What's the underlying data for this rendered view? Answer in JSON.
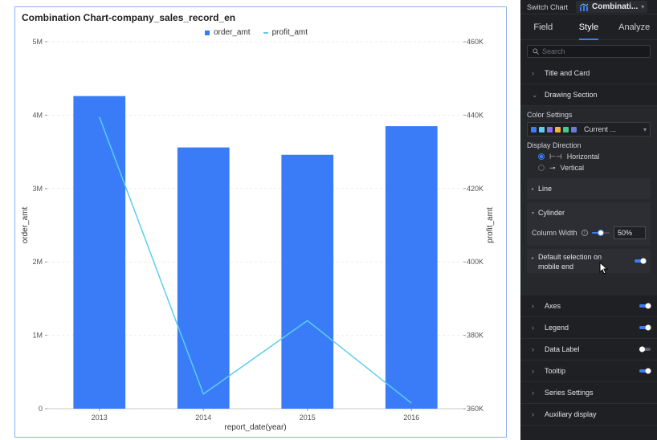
{
  "chart_data": {
    "type": "bar",
    "title": "Combination Chart-company_sales_record_en",
    "categories": [
      "2013",
      "2014",
      "2015",
      "2016"
    ],
    "series": [
      {
        "name": "order_amt",
        "type": "bar",
        "axis": "left",
        "values": [
          4260000,
          3560000,
          3460000,
          3850000
        ]
      },
      {
        "name": "profit_amt",
        "type": "line",
        "axis": "right",
        "values": [
          439500,
          364000,
          384000,
          361500
        ]
      }
    ],
    "xlabel": "report_date(year)",
    "ylabel": "order_amt",
    "y2label": "profit_amt",
    "ylim": [
      0,
      5000000
    ],
    "y2lim": [
      360000,
      460000
    ],
    "yticks": [
      "0",
      "1M",
      "2M",
      "3M",
      "4M",
      "5M"
    ],
    "y2ticks": [
      "360K",
      "380K",
      "400K",
      "420K",
      "440K",
      "460K"
    ],
    "grid": true,
    "legend_position": "top-center",
    "colors": {
      "bar": "#3a7cf7",
      "line": "#5ccdf2"
    }
  },
  "panel": {
    "switch_chart_label": "Switch Chart",
    "chart_type_label": "Combinati...",
    "tabs": [
      "Field",
      "Style",
      "Analyze"
    ],
    "active_tab": "Style",
    "search_placeholder": "Search",
    "sections": {
      "title_and_card": "Title and Card",
      "drawing_section": "Drawing Section",
      "color_settings": "Color Settings",
      "color_value": "Current ...",
      "palette": [
        "#3a7cf7",
        "#5ccdf2",
        "#8a6df2",
        "#f2b23a",
        "#45c98a",
        "#6c7bd6"
      ],
      "display_direction": "Display Direction",
      "horizontal": "Horizontal",
      "vertical": "Vertical",
      "line": "Line",
      "cylinder": "Cylinder",
      "column_width": "Column Width",
      "column_width_value": "50%",
      "default_selection": "Default selection on mobile end",
      "axes": "Axes",
      "legend": "Legend",
      "data_label": "Data Label",
      "tooltip": "Tooltip",
      "series_settings": "Series Settings",
      "auxiliary_display": "Auxiliary display"
    }
  }
}
